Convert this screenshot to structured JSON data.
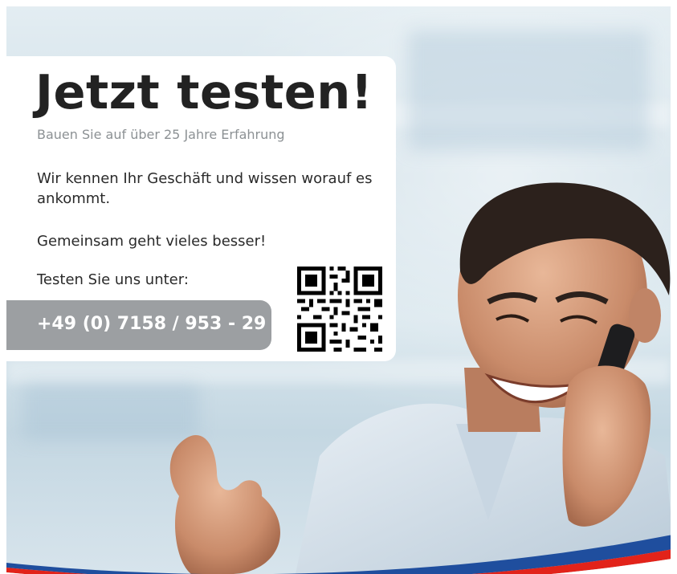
{
  "headline": "Jetzt testen!",
  "subline": "Bauen Sie auf über 25 Jahre Erfahrung",
  "paragraph1": "Wir kennen Ihr Geschäft und wissen worauf es ankommt.",
  "paragraph2": "Gemeinsam geht vieles besser!",
  "paragraph3": "Testen Sie uns unter:",
  "phone": "+49 (0) 7158 / 953 - 29",
  "colors": {
    "headline": "#222222",
    "subline": "#8c9194",
    "phone_pill": "#9c9fa2",
    "swoosh_red": "#e2231a",
    "swoosh_blue": "#1f4e9e"
  },
  "icons": [
    "qr-code-icon"
  ]
}
